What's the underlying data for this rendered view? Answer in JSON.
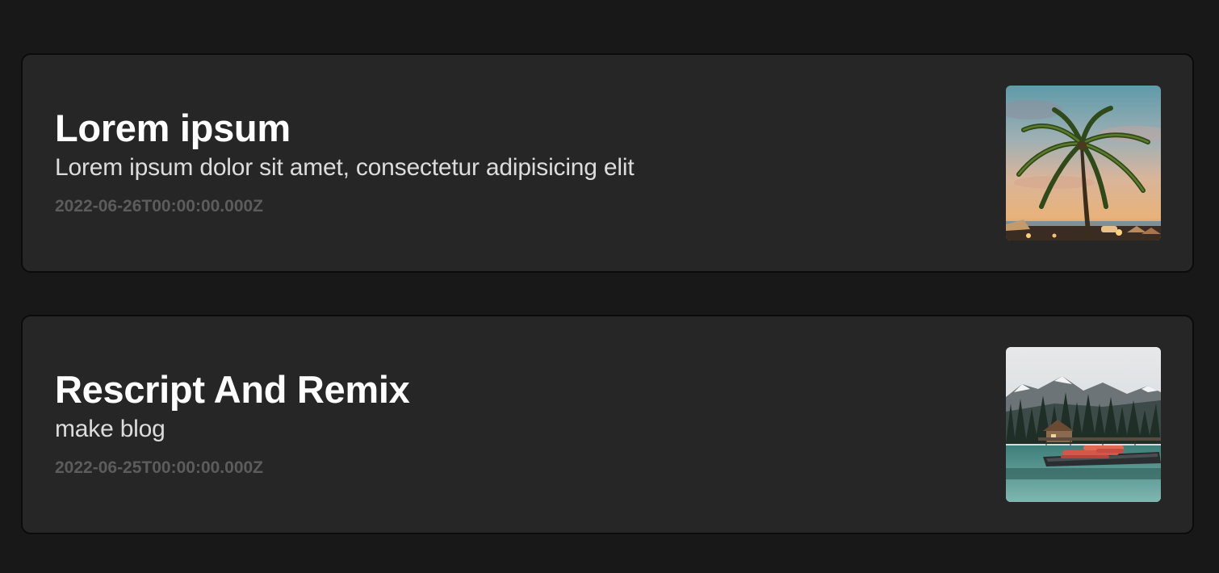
{
  "posts": [
    {
      "title": "Lorem ipsum",
      "description": "Lorem ipsum dolor sit amet, consectetur adipisicing elit",
      "date": "2022-06-26T00:00:00.000Z",
      "thumbnail": "palm-tree-beach-sunset-image"
    },
    {
      "title": "Rescript And Remix",
      "description": "make blog",
      "date": "2022-06-25T00:00:00.000Z",
      "thumbnail": "mountain-lake-cabin-canoes-image"
    }
  ],
  "colors": {
    "page_background": "#181818",
    "card_background": "#262626",
    "card_border": "#0b0b0b",
    "title": "#ffffff",
    "description": "#dcdcdc",
    "date": "#5c5c5c"
  }
}
